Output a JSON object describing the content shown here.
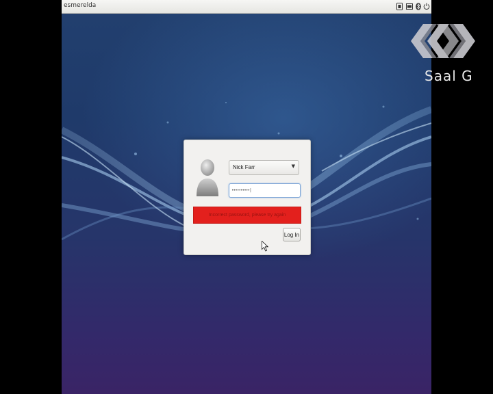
{
  "topbar": {
    "hostname": "esmerelda",
    "tray_icons": [
      "keyboard-icon",
      "battery-icon",
      "bluetooth-icon",
      "power-icon"
    ]
  },
  "login": {
    "selected_user": "Nick Farr",
    "password_masked": "••••••••••|",
    "error_message": "Incorrect password, please try again",
    "login_button_label": "Log In"
  },
  "watermark": {
    "text": "Saal G"
  },
  "colors": {
    "error": "#e3201d",
    "focus": "#7aa3d6",
    "desktop": "#22406f"
  }
}
